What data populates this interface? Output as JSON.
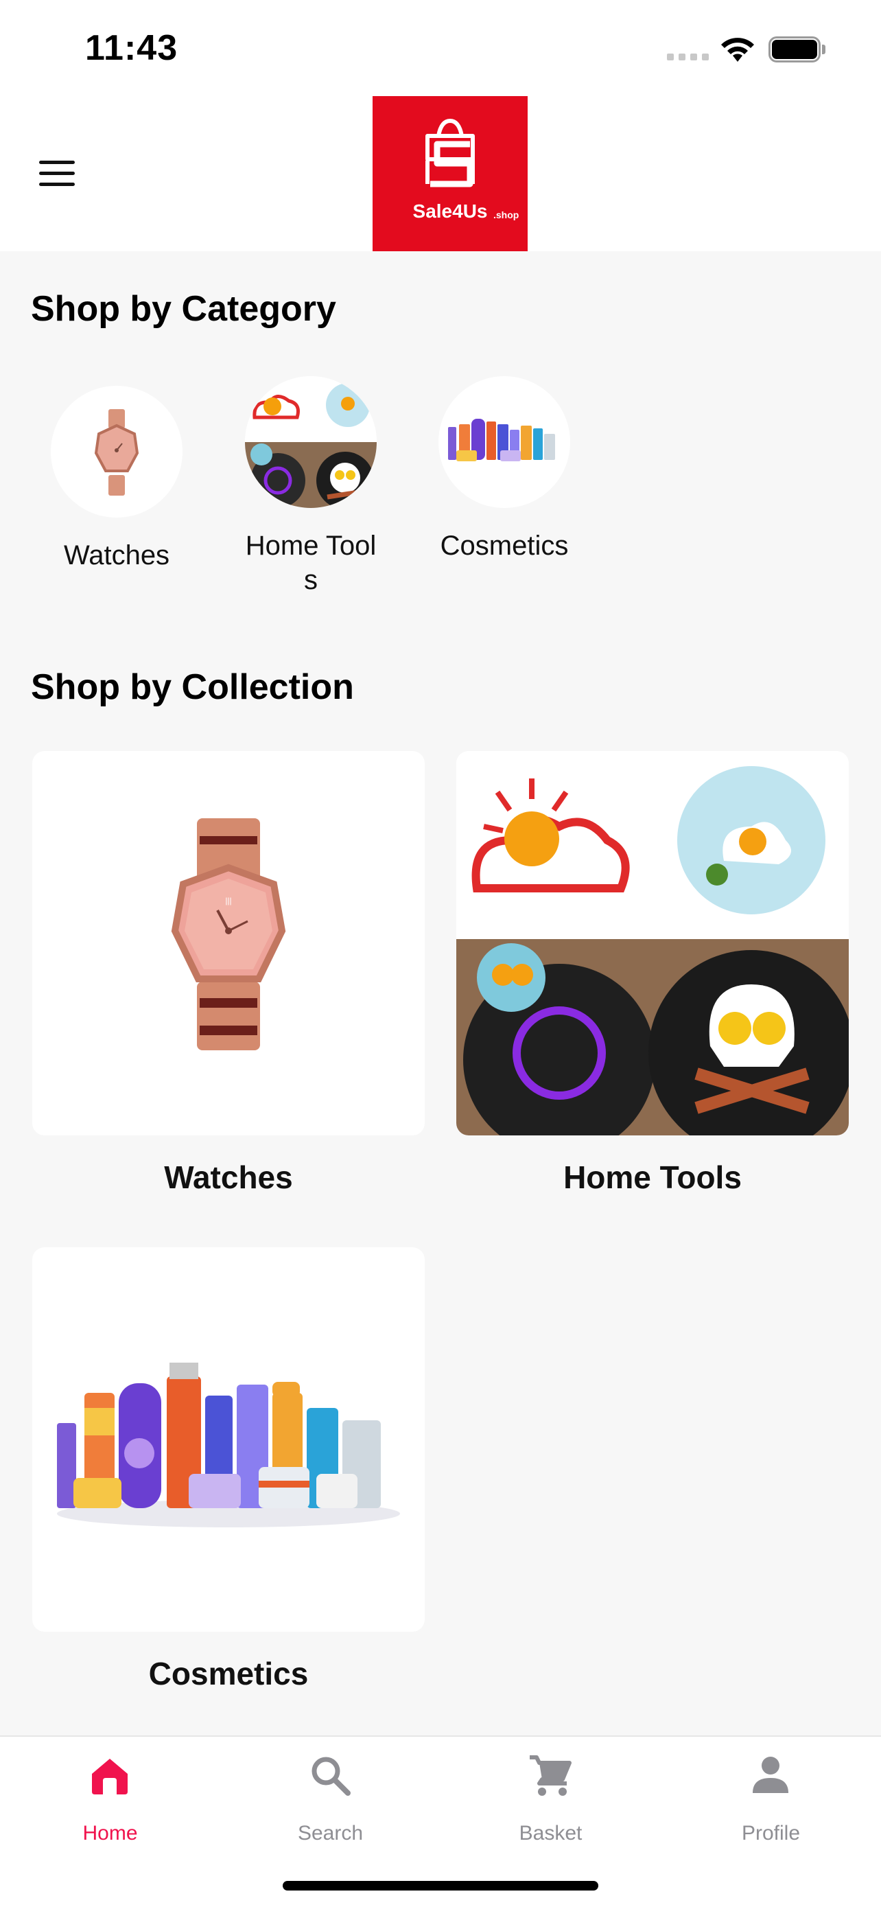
{
  "status_bar": {
    "time": "11:43"
  },
  "header": {
    "logo": {
      "brand": "Sale4Us",
      "suffix": ".shop",
      "color": "#e30b1e"
    },
    "menu_icon": "hamburger-menu-icon"
  },
  "categories": {
    "title": "Shop by Category",
    "items": [
      {
        "label": "Watches",
        "image": "watch-image"
      },
      {
        "label": "Home Tools",
        "image": "egg-mold-image"
      },
      {
        "label": "Cosmetics",
        "image": "cosmetics-image"
      }
    ]
  },
  "collections": {
    "title": "Shop by Collection",
    "items": [
      {
        "label": "Watches",
        "image": "watch-image"
      },
      {
        "label": "Home Tools",
        "image": "egg-mold-image"
      },
      {
        "label": "Cosmetics",
        "image": "cosmetics-image"
      }
    ]
  },
  "tab_bar": {
    "active_color": "#f0134d",
    "inactive_color": "#8e8e93",
    "tabs": [
      {
        "label": "Home",
        "icon": "home-icon",
        "active": true
      },
      {
        "label": "Search",
        "icon": "search-icon",
        "active": false
      },
      {
        "label": "Basket",
        "icon": "cart-icon",
        "active": false
      },
      {
        "label": "Profile",
        "icon": "profile-icon",
        "active": false
      }
    ]
  }
}
